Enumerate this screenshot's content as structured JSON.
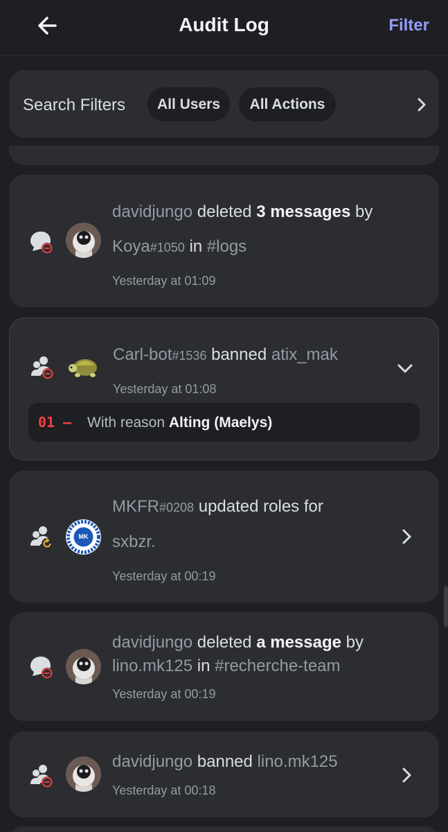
{
  "header": {
    "title": "Audit Log",
    "filter_label": "Filter"
  },
  "search_filters": {
    "label": "Search Filters",
    "users_chip": "All Users",
    "actions_chip": "All Actions"
  },
  "entries": [
    {
      "actor": "davidjungo",
      "verb": "deleted",
      "object": "3 messages",
      "by": "by",
      "target": "Koya",
      "target_disc": "#1050",
      "in": "in",
      "channel": "#logs",
      "time": "Yesterday at 01:09",
      "action_icon": "message-delete-icon"
    },
    {
      "actor": "Carl-bot",
      "actor_disc": "#1536",
      "verb": "banned",
      "target": "atix_mak",
      "time": "Yesterday at 01:08",
      "action_icon": "member-ban-icon",
      "reason": {
        "index": "01",
        "dash": "—",
        "prefix": "With reason",
        "value": "Alting (Maelys)"
      }
    },
    {
      "actor": "MKFR",
      "actor_disc": "#0208",
      "verb": "updated roles for",
      "target": "sxbzr.",
      "time": "Yesterday at 00:19",
      "action_icon": "member-role-update-icon"
    },
    {
      "actor": "davidjungo",
      "verb": "deleted",
      "object": "a message",
      "by": "by",
      "target": "lino.mk125",
      "in": "in",
      "channel": "#recherche-team",
      "time": "Yesterday at 00:19",
      "action_icon": "message-delete-icon"
    },
    {
      "actor": "davidjungo",
      "verb": "banned",
      "target": "lino.mk125",
      "time": "Yesterday at 00:18",
      "action_icon": "member-ban-icon"
    }
  ],
  "colors": {
    "background": "#1e1f22",
    "card": "#2b2d31",
    "accent": "#949cf7",
    "danger": "#f23f43",
    "muted": "#949ba4"
  }
}
